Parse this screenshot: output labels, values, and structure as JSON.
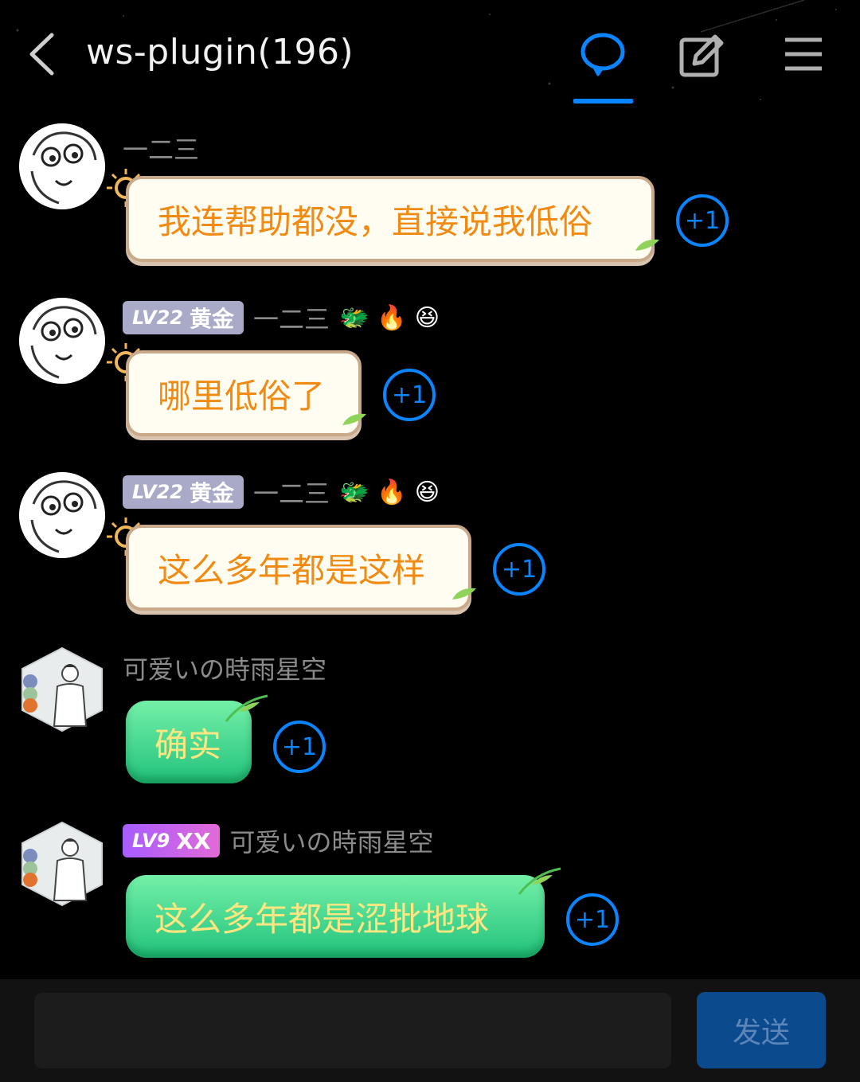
{
  "header": {
    "title": "ws-plugin(196)",
    "back_icon": "chevron-left-icon",
    "chat_icon": "chat-bubble-icon",
    "edit_icon": "edit-icon",
    "menu_icon": "menu-icon",
    "accent": "#0a84ff"
  },
  "messages": [
    {
      "name": "一二三",
      "text": "我连帮助都没，直接说我低俗",
      "plus": "+1",
      "avatar": "cartoon-face-avatar",
      "bubble_style": "cream"
    },
    {
      "badge": {
        "level": "LV22",
        "title": "黄金"
      },
      "name": "一二三",
      "emojis": [
        "🐲",
        "🔥",
        "😆"
      ],
      "text": "哪里低俗了",
      "plus": "+1",
      "avatar": "cartoon-face-avatar",
      "bubble_style": "cream"
    },
    {
      "badge": {
        "level": "LV22",
        "title": "黄金"
      },
      "name": "一二三",
      "emojis": [
        "🐲",
        "🔥",
        "😆"
      ],
      "text": "这么多年都是这样",
      "plus": "+1",
      "avatar": "cartoon-face-avatar",
      "bubble_style": "cream"
    },
    {
      "name": "可爱いの時雨星空",
      "text": "确实",
      "plus": "+1",
      "avatar": "person-illustration-avatar",
      "bubble_style": "green"
    },
    {
      "badge": {
        "level": "LV9",
        "title": "XX"
      },
      "name": "可爱いの時雨星空",
      "text": "这么多年都是涩批地球",
      "plus": "+1",
      "avatar": "person-illustration-avatar",
      "bubble_style": "green"
    }
  ],
  "composer": {
    "placeholder": "",
    "send_label": "发送"
  }
}
